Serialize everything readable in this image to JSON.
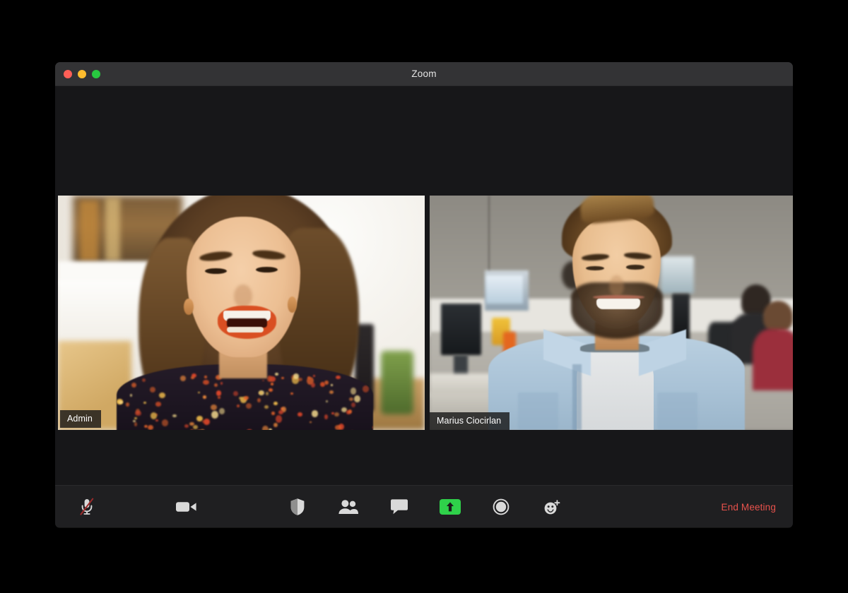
{
  "window": {
    "title": "Zoom",
    "traffic_lights": [
      {
        "name": "close",
        "color": "#ff5f57"
      },
      {
        "name": "minimize",
        "color": "#febc2e"
      },
      {
        "name": "maximize",
        "color": "#28c840"
      }
    ]
  },
  "colors": {
    "active_speaker_border": "#b9e44c",
    "share_button": "#2fd14a",
    "end_meeting_text": "#e8524c",
    "titlebar_bg": "#333335",
    "toolbar_bg": "#1f1f21",
    "canvas_bg": "#171719",
    "page_bg": "#000000"
  },
  "participants": [
    {
      "name": "Admin",
      "active_speaker": true,
      "scene": "woman laughing, brown wavy hair, orange lipstick, dark floral top, bright white kitchen background"
    },
    {
      "name": "Marius Ciocirlan",
      "active_speaker": false,
      "scene": "smiling bearded man with swept-up hair in light blue denim shirt, open-plan concrete office with monitors and colleagues"
    }
  ],
  "toolbar": {
    "buttons": [
      {
        "id": "mute",
        "icon": "microphone-muted-icon",
        "label": "Mute",
        "state": "muted"
      },
      {
        "id": "video",
        "icon": "video-camera-icon",
        "label": "Start Video",
        "state": "on"
      },
      {
        "id": "security",
        "icon": "shield-icon",
        "label": "Security"
      },
      {
        "id": "participants",
        "icon": "participants-icon",
        "label": "Participants"
      },
      {
        "id": "chat",
        "icon": "chat-bubble-icon",
        "label": "Chat"
      },
      {
        "id": "share",
        "icon": "share-screen-icon",
        "label": "Share Screen"
      },
      {
        "id": "record",
        "icon": "record-circle-icon",
        "label": "Record"
      },
      {
        "id": "reactions",
        "icon": "reactions-smiley-icon",
        "label": "Reactions"
      }
    ],
    "end_meeting_label": "End Meeting"
  }
}
